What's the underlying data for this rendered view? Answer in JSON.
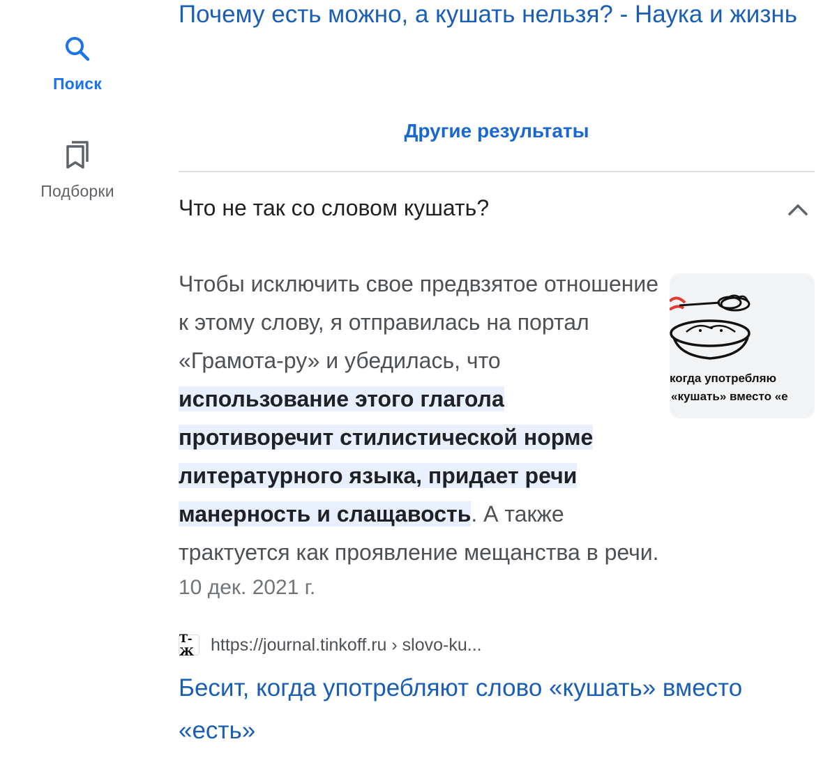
{
  "rail": {
    "search_label": "Поиск",
    "collections_label": "Подборки"
  },
  "previous_result": {
    "title": "Почему есть можно, а кушать нельзя? - Наука и жизнь"
  },
  "more_results_label": "Другие результаты",
  "faq": {
    "question": "Что не так со словом кушать?",
    "answer_before": "Чтобы исключить свое предвзятое отношение к этому слову, я отправилась на портал «Грамота-ру» и убедилась, что ",
    "answer_highlight": "использование этого глагола противоречит стилистической норме литературного языка, придает речи манерность и слащавость",
    "answer_after": ". А также трактуется как проявление мещанства в речи.",
    "date": "10 дек. 2021 г.",
    "thumbnail_caption_line1": "когда употребляю",
    "thumbnail_caption_line2": "«кушать» вместо «е",
    "source_favicon": "Т-Ж",
    "source_url": "https://journal.tinkoff.ru › slovo-ku...",
    "result_title": "Бесит, когда употребляют слово «кушать» вместо «есть»"
  },
  "colors": {
    "link": "#1a5fb4",
    "accent": "#1a73e8",
    "highlight": "#e8f0fe"
  }
}
